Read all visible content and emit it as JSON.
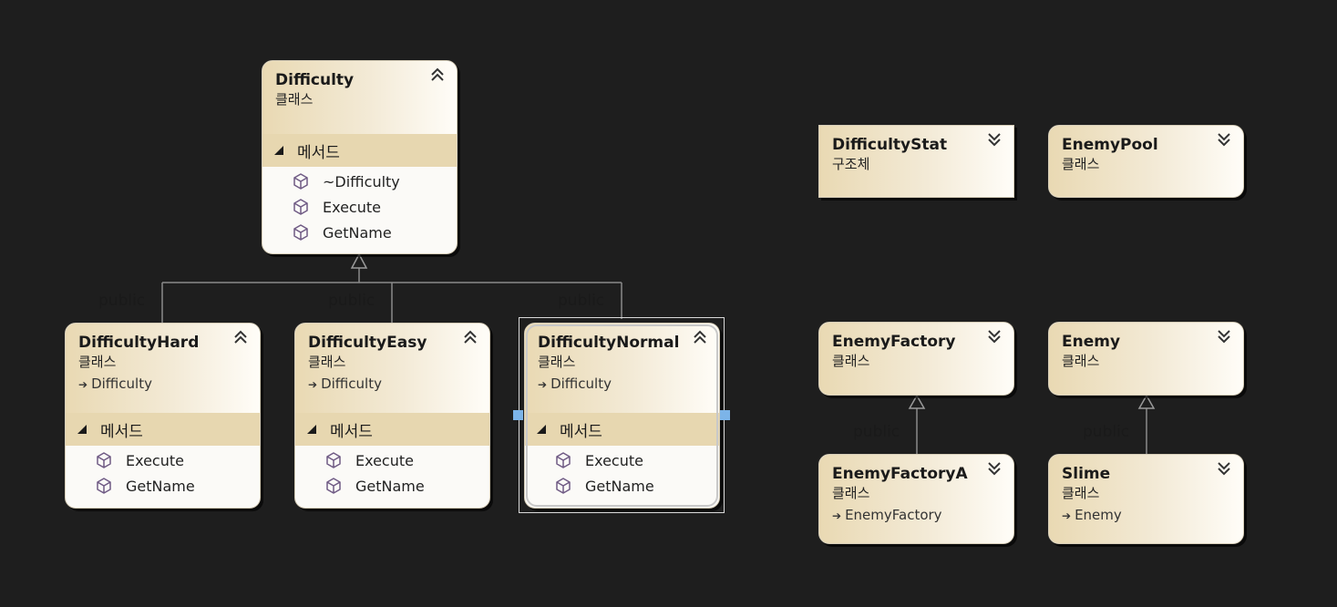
{
  "colors": {
    "background": "#1e1e1e",
    "header": "#e9d9b3",
    "section": "#e7d7b0",
    "body": "#fbfaf7",
    "handle": "#7cb4e8",
    "icon": "#6f5a84"
  },
  "classes": {
    "difficulty": {
      "name": "Difficulty",
      "kind": "클래스",
      "section": "메서드",
      "members": [
        "~Difficulty",
        "Execute",
        "GetName"
      ]
    },
    "difficulty_hard": {
      "name": "DifficultyHard",
      "kind": "클래스",
      "base": "Difficulty",
      "section": "메서드",
      "members": [
        "Execute",
        "GetName"
      ]
    },
    "difficulty_easy": {
      "name": "DifficultyEasy",
      "kind": "클래스",
      "base": "Difficulty",
      "section": "메서드",
      "members": [
        "Execute",
        "GetName"
      ]
    },
    "difficulty_normal": {
      "name": "DifficultyNormal",
      "kind": "클래스",
      "base": "Difficulty",
      "section": "메서드",
      "members": [
        "Execute",
        "GetName"
      ]
    },
    "difficulty_stat": {
      "name": "DifficultyStat",
      "kind": "구조체"
    },
    "enemy_pool": {
      "name": "EnemyPool",
      "kind": "클래스"
    },
    "enemy_factory": {
      "name": "EnemyFactory",
      "kind": "클래스"
    },
    "enemy": {
      "name": "Enemy",
      "kind": "클래스"
    },
    "enemy_factory_a": {
      "name": "EnemyFactoryA",
      "kind": "클래스",
      "base": "EnemyFactory"
    },
    "slime": {
      "name": "Slime",
      "kind": "클래스",
      "base": "Enemy"
    }
  },
  "inheritance_labels": {
    "hard": "public",
    "easy": "public",
    "normal": "public",
    "factory_a": "public",
    "slime": "public"
  },
  "icons": {
    "collapse": "double-chevron-up-icon",
    "expand": "double-chevron-down-icon",
    "method": "method-cube-icon",
    "section": "section-triangle-icon",
    "base": "inherit-arrow-icon"
  }
}
